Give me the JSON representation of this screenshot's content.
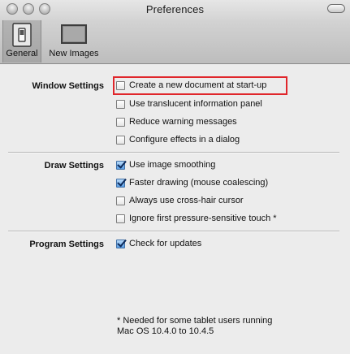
{
  "window": {
    "title": "Preferences"
  },
  "toolbar": {
    "items": [
      {
        "label": "General",
        "icon": "light-switch-icon",
        "selected": true
      },
      {
        "label": "New Images",
        "icon": "blank-canvas-icon",
        "selected": false
      }
    ]
  },
  "sections": {
    "window": {
      "label": "Window Settings",
      "options": [
        {
          "label": "Create a new document at start-up",
          "checked": false,
          "highlighted": true
        },
        {
          "label": "Use translucent information panel",
          "checked": false
        },
        {
          "label": "Reduce warning messages",
          "checked": false
        },
        {
          "label": "Configure effects in a dialog",
          "checked": false
        }
      ]
    },
    "draw": {
      "label": "Draw Settings",
      "options": [
        {
          "label": "Use image smoothing",
          "checked": true
        },
        {
          "label": "Faster drawing (mouse coalescing)",
          "checked": true
        },
        {
          "label": "Always use cross-hair cursor",
          "checked": false
        },
        {
          "label": "Ignore first pressure-sensitive touch *",
          "checked": false
        }
      ]
    },
    "program": {
      "label": "Program Settings",
      "options": [
        {
          "label": "Check for updates",
          "checked": true
        }
      ]
    }
  },
  "footnote": {
    "line1": "* Needed for some tablet users running",
    "line2": "Mac OS 10.4.0 to 10.4.5"
  },
  "colors": {
    "highlight": "#e0262b",
    "checkbox_on": "#5a9ee4"
  }
}
